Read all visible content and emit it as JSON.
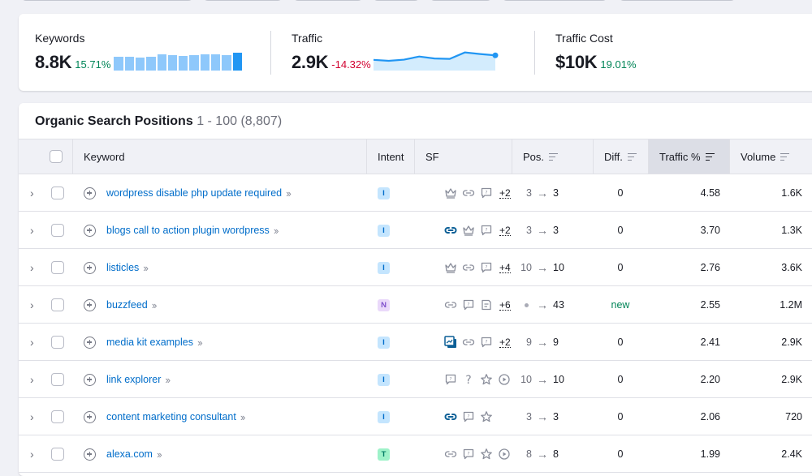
{
  "summary": {
    "keywords": {
      "label": "Keywords",
      "value": "8.8K",
      "delta": "15.71%",
      "trend": "up",
      "sparkline_relative": [
        0.85,
        0.86,
        0.84,
        0.88,
        1.0,
        0.96,
        0.9,
        0.95,
        1.0,
        1.0,
        0.98,
        1.12
      ]
    },
    "traffic": {
      "label": "Traffic",
      "value": "2.9K",
      "delta": "-14.32%",
      "trend": "down",
      "sparkline_relative": [
        0.55,
        0.5,
        0.56,
        0.72,
        0.62,
        0.6,
        0.93,
        0.85,
        0.78
      ]
    },
    "traffic_cost": {
      "label": "Traffic Cost",
      "value": "$10K",
      "delta": "19.01%",
      "trend": "up"
    }
  },
  "table": {
    "title": "Organic Search Positions",
    "range": "1 - 100 (8,807)",
    "columns": {
      "keyword": "Keyword",
      "intent": "Intent",
      "sf": "SF",
      "pos": "Pos.",
      "diff": "Diff.",
      "traffic": "Traffic %",
      "volume": "Volume"
    },
    "sorted_column": "Traffic %",
    "rows": [
      {
        "keyword": "wordpress disable php update required",
        "intent": "I",
        "sf": [
          "crown",
          "link",
          "faq"
        ],
        "sf_active": [],
        "sf_more": "+2",
        "pos_from": "3",
        "pos_to": "3",
        "diff": "0",
        "traffic": "4.58",
        "volume": "1.6K"
      },
      {
        "keyword": "blogs call to action plugin wordpress",
        "intent": "I",
        "sf": [
          "link",
          "crown",
          "faq"
        ],
        "sf_active": [
          "link"
        ],
        "sf_more": "+2",
        "pos_from": "3",
        "pos_to": "3",
        "diff": "0",
        "traffic": "3.70",
        "volume": "1.3K"
      },
      {
        "keyword": "listicles",
        "intent": "I",
        "sf": [
          "crown",
          "link",
          "faq"
        ],
        "sf_active": [],
        "sf_more": "+4",
        "pos_from": "10",
        "pos_to": "10",
        "diff": "0",
        "traffic": "2.76",
        "volume": "3.6K"
      },
      {
        "keyword": "buzzfeed",
        "intent": "N",
        "sf": [
          "link",
          "faq",
          "article"
        ],
        "sf_active": [],
        "sf_more": "+6",
        "pos_from": "",
        "pos_to": "43",
        "diff": "new",
        "traffic": "2.55",
        "volume": "1.2M"
      },
      {
        "keyword": "media kit examples",
        "intent": "I",
        "sf": [
          "images",
          "link",
          "faq"
        ],
        "sf_active": [
          "images"
        ],
        "sf_more": "+2",
        "pos_from": "9",
        "pos_to": "9",
        "diff": "0",
        "traffic": "2.41",
        "volume": "2.9K"
      },
      {
        "keyword": "link explorer",
        "intent": "I",
        "sf": [
          "faq",
          "question",
          "star",
          "video"
        ],
        "sf_active": [],
        "sf_more": "",
        "pos_from": "10",
        "pos_to": "10",
        "diff": "0",
        "traffic": "2.20",
        "volume": "2.9K"
      },
      {
        "keyword": "content marketing consultant",
        "intent": "I",
        "sf": [
          "link",
          "faq",
          "star"
        ],
        "sf_active": [
          "link"
        ],
        "sf_more": "",
        "pos_from": "3",
        "pos_to": "3",
        "diff": "0",
        "traffic": "2.06",
        "volume": "720"
      },
      {
        "keyword": "alexa.com",
        "intent": "T",
        "sf": [
          "link",
          "faq",
          "star",
          "video"
        ],
        "sf_active": [],
        "sf_more": "",
        "pos_from": "8",
        "pos_to": "8",
        "diff": "0",
        "traffic": "1.99",
        "volume": "2.4K"
      }
    ]
  },
  "colors": {
    "link": "#006dca",
    "positive": "#008557",
    "negative": "#d1002f",
    "sparkline": "#2196f3",
    "sparkline_fill": "#d3ecfd",
    "sf_active": "#0b5f96",
    "sf_inactive": "#8a8e9b"
  }
}
